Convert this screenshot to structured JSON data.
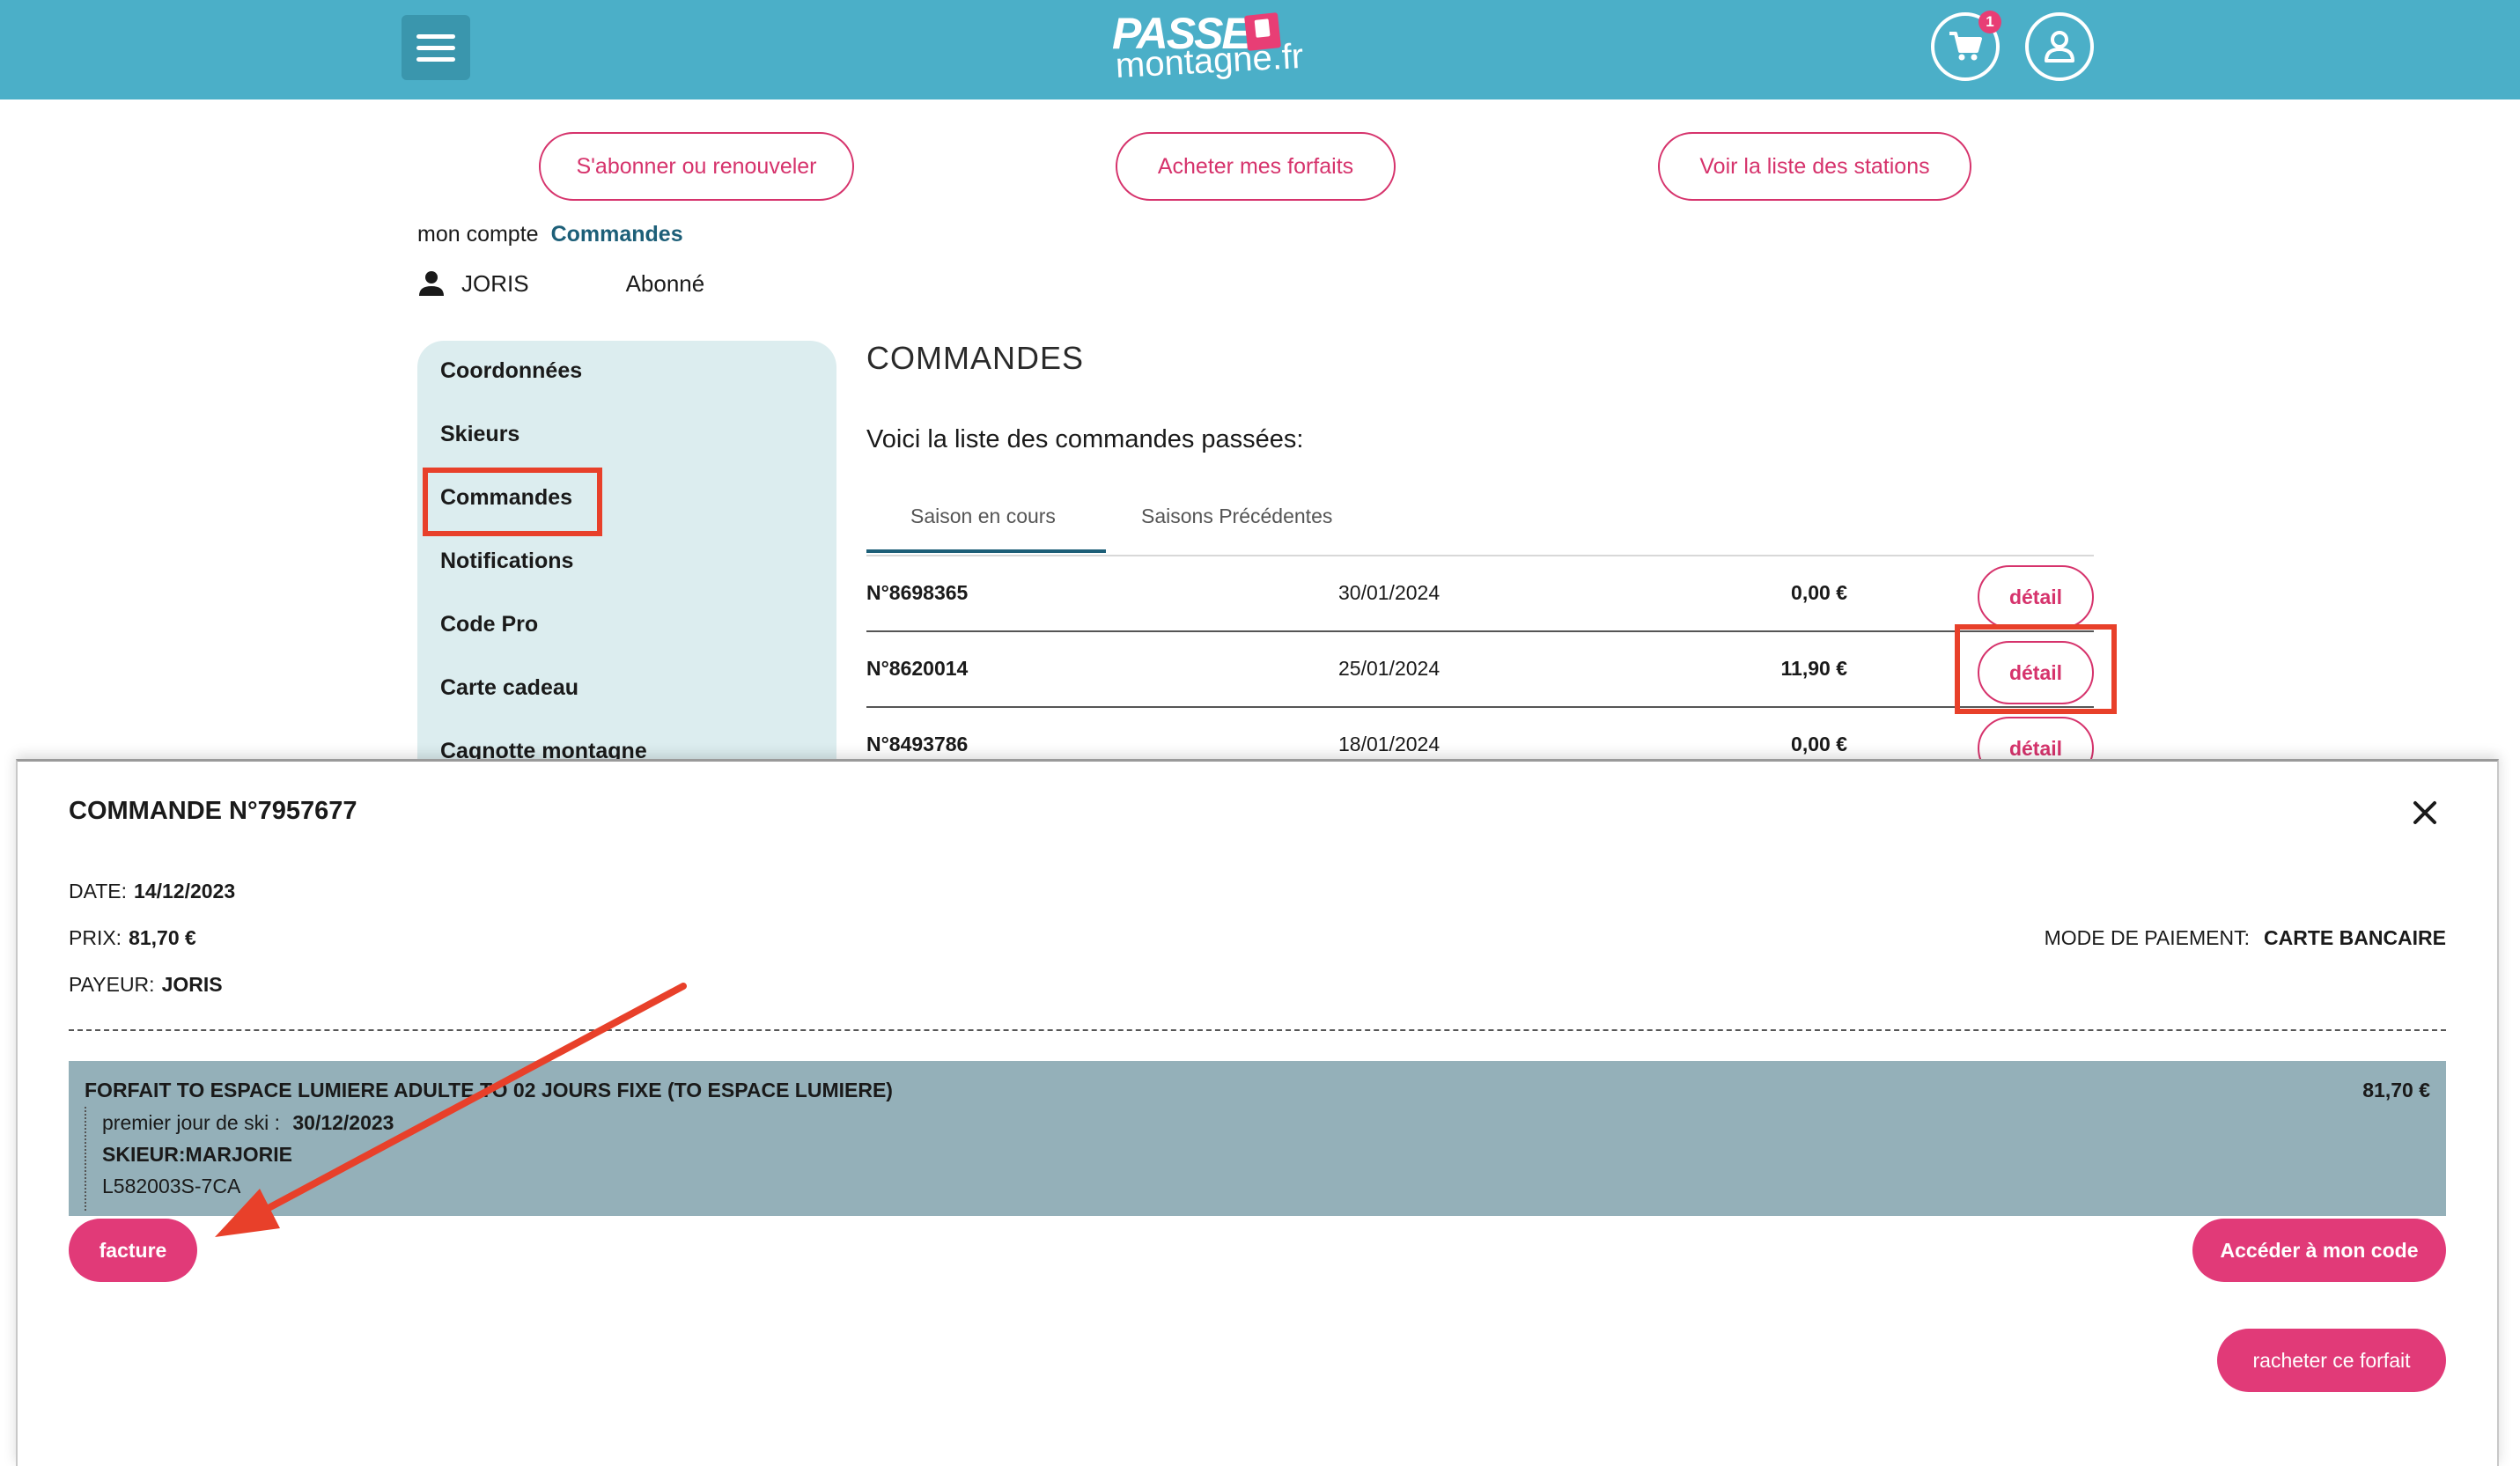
{
  "header": {
    "logo_line1": "PASSE",
    "logo_line2": "montagne.fr",
    "cart_count": "1",
    "icons": {
      "menu": "hamburger-menu-icon",
      "cart": "cart-icon",
      "user": "user-icon"
    }
  },
  "top_actions": {
    "subscribe": "S'abonner ou renouveler",
    "buy": "Acheter mes forfaits",
    "stations": "Voir la liste des stations"
  },
  "breadcrumb": {
    "home": "mon compte",
    "current": "Commandes"
  },
  "user": {
    "name": "JORIS",
    "status": "Abonné"
  },
  "sidebar": {
    "items": [
      {
        "label": "Coordonnées"
      },
      {
        "label": "Skieurs"
      },
      {
        "label": "Commandes"
      },
      {
        "label": "Notifications"
      },
      {
        "label": "Code Pro"
      },
      {
        "label": "Carte cadeau"
      },
      {
        "label": "Cagnotte montagne"
      }
    ],
    "active": "Commandes"
  },
  "main": {
    "title": "COMMANDES",
    "intro": "Voici la liste des commandes passées:",
    "tabs": [
      {
        "label": "Saison en cours"
      },
      {
        "label": "Saisons Précédentes"
      }
    ],
    "detail_label": "détail",
    "orders": [
      {
        "number": "N°8698365",
        "date": "30/01/2024",
        "price": "0,00 €"
      },
      {
        "number": "N°8620014",
        "date": "25/01/2024",
        "price": "11,90 €"
      },
      {
        "number": "N°8493786",
        "date": "18/01/2024",
        "price": "0,00 €"
      }
    ]
  },
  "modal": {
    "title": "COMMANDE N°7957677",
    "date_label": "DATE:",
    "date_value": "14/12/2023",
    "price_label": "PRIX:",
    "price_value": "81,70 €",
    "payer_label": "PAYEUR:",
    "payer_value": "JORIS",
    "payment_label": "MODE DE PAIEMENT:",
    "payment_value": "CARTE BANCAIRE",
    "item": {
      "name": "FORFAIT TO ESPACE LUMIERE ADULTE TO 02 JOURS FIXE (TO ESPACE LUMIERE)",
      "price": "81,70 €",
      "first_day_label": "premier jour de ski :",
      "first_day_value": "30/12/2023",
      "skier": "SKIEUR:MARJORIE",
      "code": "L582003S-7CA"
    },
    "invoice_button": "facture",
    "access_code_button": "Accéder à mon code",
    "rebuy_button": "racheter ce forfait"
  },
  "colors": {
    "header": "#4bafc8",
    "accent_pink": "#e13a78",
    "annotation_red": "#e8402a",
    "sidebar_bg": "#dcedef",
    "item_bg": "#94b0b9"
  }
}
